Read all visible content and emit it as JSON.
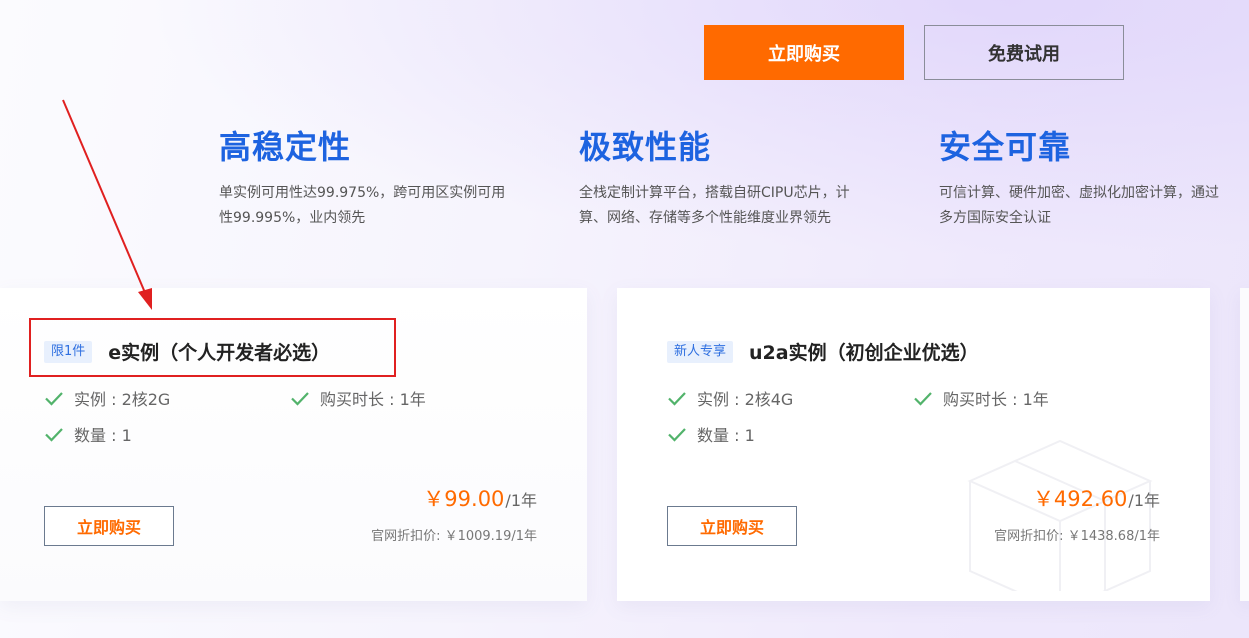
{
  "top_buttons": {
    "buy_label": "立即购买",
    "trial_label": "免费试用"
  },
  "features": [
    {
      "title": "高稳定性",
      "desc_line1": "单实例可用性达99.975%，跨可用区实例可用",
      "desc_line2": "性99.995%，业内领先"
    },
    {
      "title": "极致性能",
      "desc_line1": "全栈定制计算平台，搭载自研CIPU芯片，计",
      "desc_line2": "算、网络、存储等多个性能维度业界领先"
    },
    {
      "title": "安全可靠",
      "desc_line1": "可信计算、硬件加密、虚拟化加密计算，通过",
      "desc_line2": "多方国际安全认证"
    }
  ],
  "cards": [
    {
      "tag": "限1件",
      "title": "e实例（个人开发者必选）",
      "specs": [
        "实例 : 2核2G",
        "购买时长 : 1年",
        "数量 : 1"
      ],
      "price": "￥99.00",
      "price_unit": "/1年",
      "original_price": "官网折扣价: ￥1009.19/1年",
      "buy_label": "立即购买"
    },
    {
      "tag": "新人专享",
      "title": "u2a实例（初创企业优选）",
      "specs": [
        "实例 : 2核4G",
        "购买时长 : 1年",
        "数量 : 1"
      ],
      "price": "￥492.60",
      "price_unit": "/1年",
      "original_price": "官网折扣价: ￥1438.68/1年",
      "buy_label": "立即购买"
    }
  ],
  "colors": {
    "accent_orange": "#ff6a00",
    "feature_blue": "#1d63e0",
    "check_green": "#52b36b",
    "annotation_red": "#e02020"
  },
  "icons": {
    "check": "check-icon"
  }
}
